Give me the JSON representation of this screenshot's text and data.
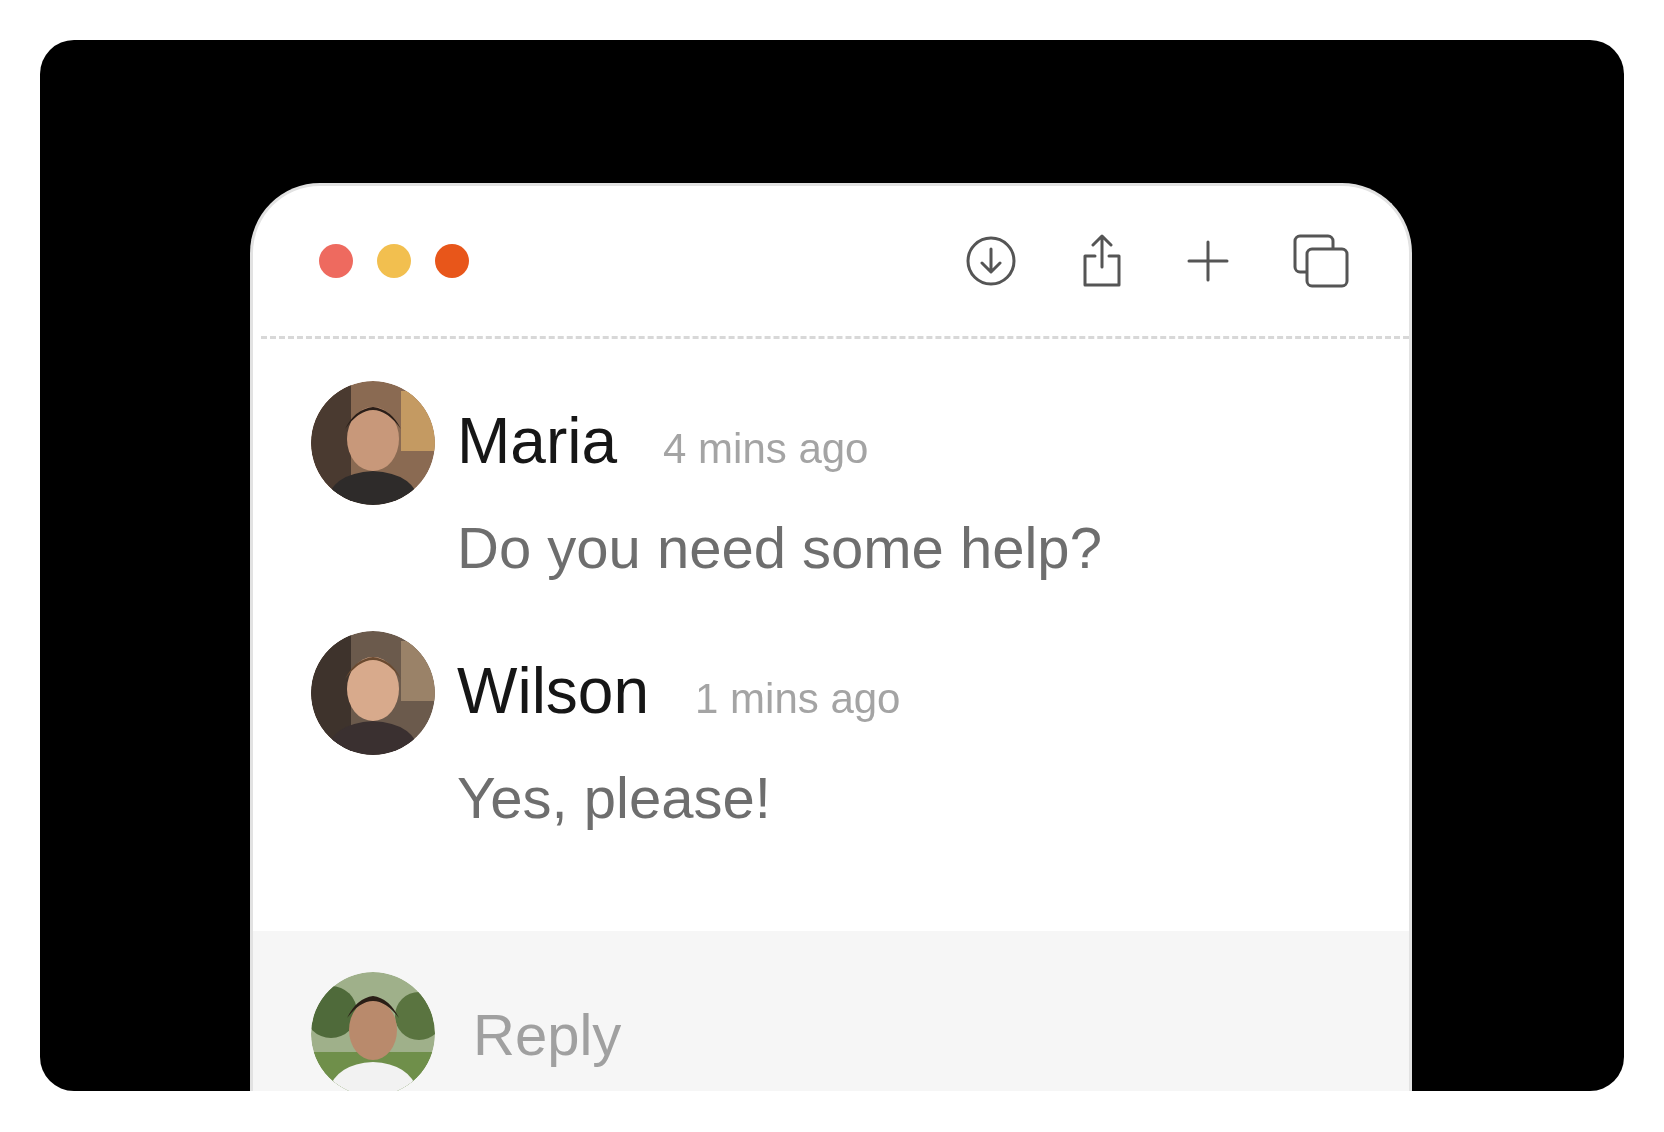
{
  "window_controls": [
    {
      "color": "#ee6a5f"
    },
    {
      "color": "#f2bf4f"
    },
    {
      "color": "#e8561a"
    }
  ],
  "toolbar": [
    {
      "kind": "download"
    },
    {
      "kind": "share"
    },
    {
      "kind": "add"
    },
    {
      "kind": "copy"
    }
  ],
  "messages": [
    {
      "name": "Maria",
      "time": "4 mins ago",
      "text": "Do you need some help?"
    },
    {
      "name": "Wilson",
      "time": "1 mins ago",
      "text": "Yes, please!"
    }
  ],
  "reply": {
    "placeholder": "Reply"
  }
}
